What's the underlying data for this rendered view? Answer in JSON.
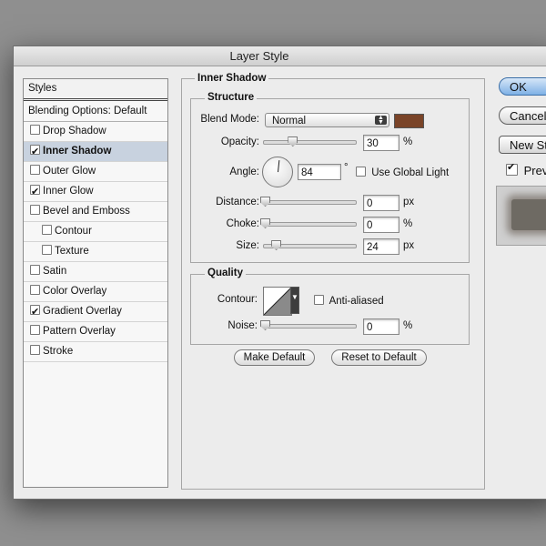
{
  "window": {
    "title": "Layer Style"
  },
  "styles_panel": {
    "header": "Styles",
    "blending_options": "Blending Options: Default",
    "items": [
      {
        "label": "Drop Shadow",
        "checked": false,
        "selected": false,
        "indent": false
      },
      {
        "label": "Inner Shadow",
        "checked": true,
        "selected": true,
        "indent": false
      },
      {
        "label": "Outer Glow",
        "checked": false,
        "selected": false,
        "indent": false
      },
      {
        "label": "Inner Glow",
        "checked": true,
        "selected": false,
        "indent": false
      },
      {
        "label": "Bevel and Emboss",
        "checked": false,
        "selected": false,
        "indent": false
      },
      {
        "label": "Contour",
        "checked": false,
        "selected": false,
        "indent": true
      },
      {
        "label": "Texture",
        "checked": false,
        "selected": false,
        "indent": true
      },
      {
        "label": "Satin",
        "checked": false,
        "selected": false,
        "indent": false
      },
      {
        "label": "Color Overlay",
        "checked": false,
        "selected": false,
        "indent": false
      },
      {
        "label": "Gradient Overlay",
        "checked": true,
        "selected": false,
        "indent": false
      },
      {
        "label": "Pattern Overlay",
        "checked": false,
        "selected": false,
        "indent": false
      },
      {
        "label": "Stroke",
        "checked": false,
        "selected": false,
        "indent": false
      }
    ]
  },
  "inner_shadow": {
    "title": "Inner Shadow",
    "structure": {
      "title": "Structure",
      "blend_mode_label": "Blend Mode:",
      "blend_mode_value": "Normal",
      "blend_color": "#7a4428",
      "opacity_label": "Opacity:",
      "opacity_value": "30",
      "opacity_unit": "%",
      "opacity_fraction": 0.3,
      "angle_label": "Angle:",
      "angle_value": "84",
      "angle_unit": "°",
      "use_global_light_label": "Use Global Light",
      "use_global_light_checked": false,
      "distance_label": "Distance:",
      "distance_value": "0",
      "distance_unit": "px",
      "distance_fraction": 0.0,
      "choke_label": "Choke:",
      "choke_value": "0",
      "choke_unit": "%",
      "choke_fraction": 0.0,
      "size_label": "Size:",
      "size_value": "24",
      "size_unit": "px",
      "size_fraction": 0.12
    },
    "quality": {
      "title": "Quality",
      "contour_label": "Contour:",
      "anti_aliased_label": "Anti-aliased",
      "anti_aliased_checked": false,
      "noise_label": "Noise:",
      "noise_value": "0",
      "noise_unit": "%",
      "noise_fraction": 0.0
    },
    "make_default_label": "Make Default",
    "reset_default_label": "Reset to Default"
  },
  "actions": {
    "ok_label": "OK",
    "cancel_label": "Cancel",
    "new_style_label": "New Style...",
    "preview_label": "Preview",
    "preview_checked": true
  },
  "colors": {
    "selected_row": "#c8d2df",
    "default_button": "#7fb1e6",
    "background": "#8f8f8f"
  }
}
